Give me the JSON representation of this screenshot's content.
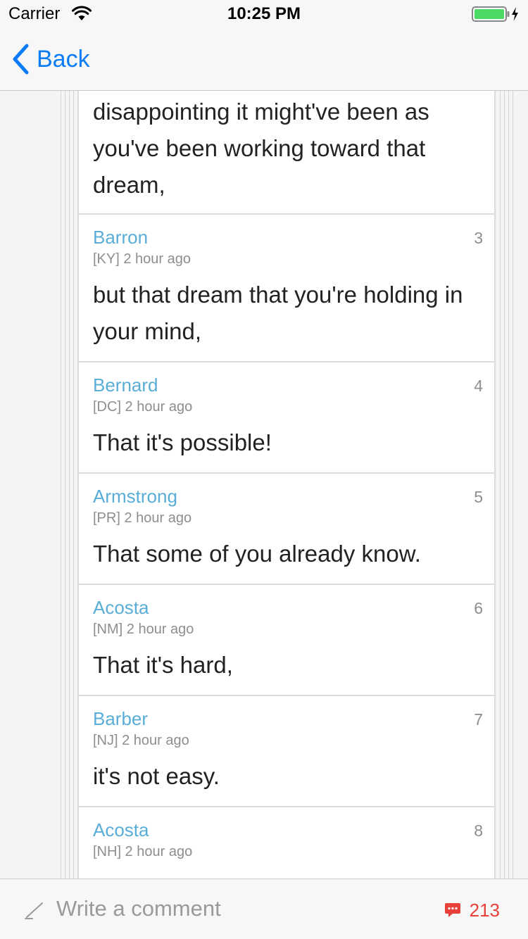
{
  "status_bar": {
    "carrier": "Carrier",
    "time": "10:25 PM"
  },
  "nav": {
    "back_label": "Back"
  },
  "thread": {
    "first_text": "disappointing it might've been as you've been working toward that dream,",
    "posts": [
      {
        "author": "Barron",
        "meta": "[KY] 2 hour ago",
        "number": "3",
        "text": "but that dream that you're holding in your mind,"
      },
      {
        "author": "Bernard",
        "meta": "[DC] 2 hour ago",
        "number": "4",
        "text": "That it's possible!"
      },
      {
        "author": "Armstrong",
        "meta": "[PR] 2 hour ago",
        "number": "5",
        "text": "That some of you already know."
      },
      {
        "author": "Acosta",
        "meta": "[NM] 2 hour ago",
        "number": "6",
        "text": "That it's hard,"
      },
      {
        "author": "Barber",
        "meta": "[NJ] 2 hour ago",
        "number": "7",
        "text": "it's not easy."
      },
      {
        "author": "Acosta",
        "meta": "[NH] 2 hour ago",
        "number": "8",
        "text": ""
      }
    ]
  },
  "bottom_bar": {
    "comment_placeholder": "Write a comment",
    "comment_count": "213"
  },
  "colors": {
    "accent": "#0a7cf5",
    "author": "#5aadd6",
    "count": "#e8403a",
    "battery": "#4cd964"
  },
  "icons": [
    "wifi-icon",
    "battery-icon",
    "charging-bolt-icon",
    "back-chevron-icon",
    "pencil-icon",
    "comment-bubble-icon"
  ]
}
